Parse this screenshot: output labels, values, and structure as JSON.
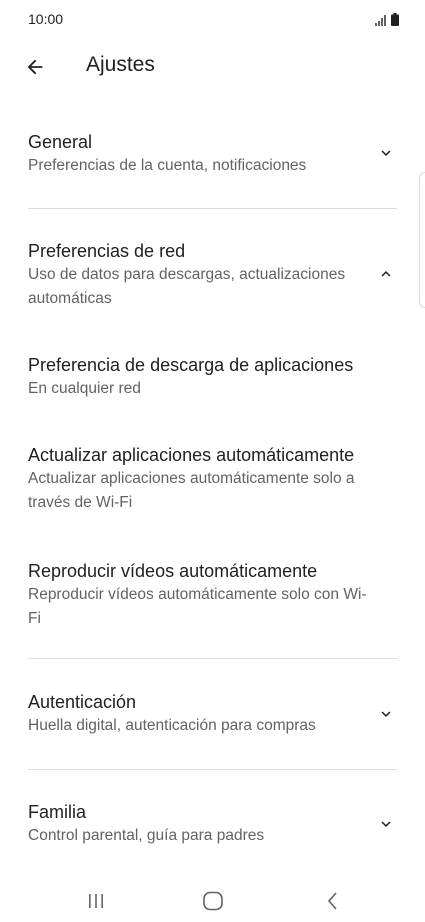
{
  "status_bar": {
    "time": "10:00",
    "icons": [
      "signal-icon",
      "battery-icon"
    ]
  },
  "app_bar": {
    "title": "Ajustes",
    "back_icon": "arrow-back-icon"
  },
  "sections": [
    {
      "title": "General",
      "subtitle": "Preferencias de la cuenta, notificaciones",
      "expanded": false
    },
    {
      "title": "Preferencias de red",
      "subtitle": "Uso de datos para descargas, actualizaciones automáticas",
      "expanded": true,
      "items": [
        {
          "title": "Preferencia de descarga de aplicaciones",
          "subtitle": "En cualquier red"
        },
        {
          "title": "Actualizar aplicaciones automáticamente",
          "subtitle": "Actualizar aplicaciones automáticamente solo a través de Wi-Fi"
        },
        {
          "title": "Reproducir vídeos automáticamente",
          "subtitle": "Reproducir vídeos automáticamente solo con Wi-Fi"
        }
      ]
    },
    {
      "title": "Autenticación",
      "subtitle": "Huella digital, autenticación para compras",
      "expanded": false
    },
    {
      "title": "Familia",
      "subtitle": "Control parental, guía para padres",
      "expanded": false
    }
  ],
  "nav_bar": {
    "buttons": [
      "recents-icon",
      "home-icon",
      "back-icon"
    ]
  },
  "colors": {
    "text_primary": "#202124",
    "text_secondary": "#5f6368",
    "divider": "#dadce0"
  }
}
